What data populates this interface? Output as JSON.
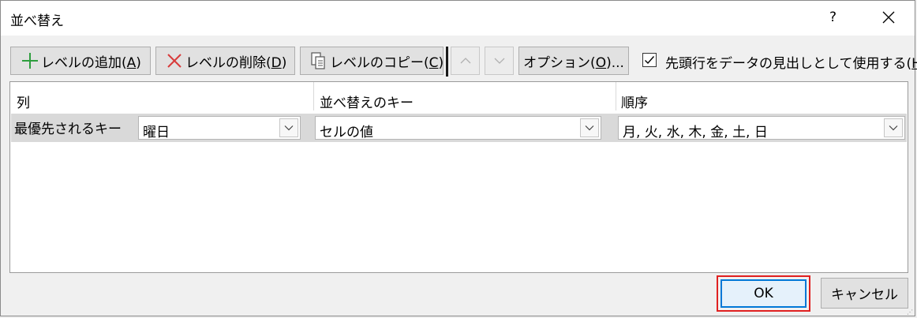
{
  "window": {
    "title": "並べ替え",
    "help_label": "?"
  },
  "toolbar": {
    "add_level": {
      "text": "レベルの追加(",
      "key": "A",
      "suffix": ")",
      "icon": "plus-icon"
    },
    "delete_level": {
      "text": "レベルの削除(",
      "key": "D",
      "suffix": ")",
      "icon": "x-icon"
    },
    "copy_level": {
      "text": "レベルのコピー(",
      "key": "C",
      "suffix": ")",
      "icon": "copy-icon"
    },
    "move_up": {
      "icon": "chevron-up-icon",
      "enabled": false
    },
    "move_down": {
      "icon": "chevron-down-icon",
      "enabled": false
    },
    "options": {
      "text": "オプション(",
      "key": "O",
      "suffix": ")..."
    },
    "has_headers": {
      "checked": true,
      "text": "先頭行をデータの見出しとして使用する(",
      "key": "H",
      "suffix": ")"
    }
  },
  "grid": {
    "headers": {
      "column": "列",
      "sort_on": "並べ替えのキー",
      "order": "順序"
    },
    "rows": [
      {
        "label": "最優先されるキー",
        "column": "曜日",
        "sort_on": "セルの値",
        "order": "月, 火, 水, 木, 金, 土, 日"
      }
    ]
  },
  "footer": {
    "ok_label": "OK",
    "cancel_label": "キャンセル"
  },
  "colors": {
    "ok_border": "#0078d7",
    "highlight": "#e02020",
    "plus": "#2e9e3e",
    "x": "#d83b3b"
  }
}
